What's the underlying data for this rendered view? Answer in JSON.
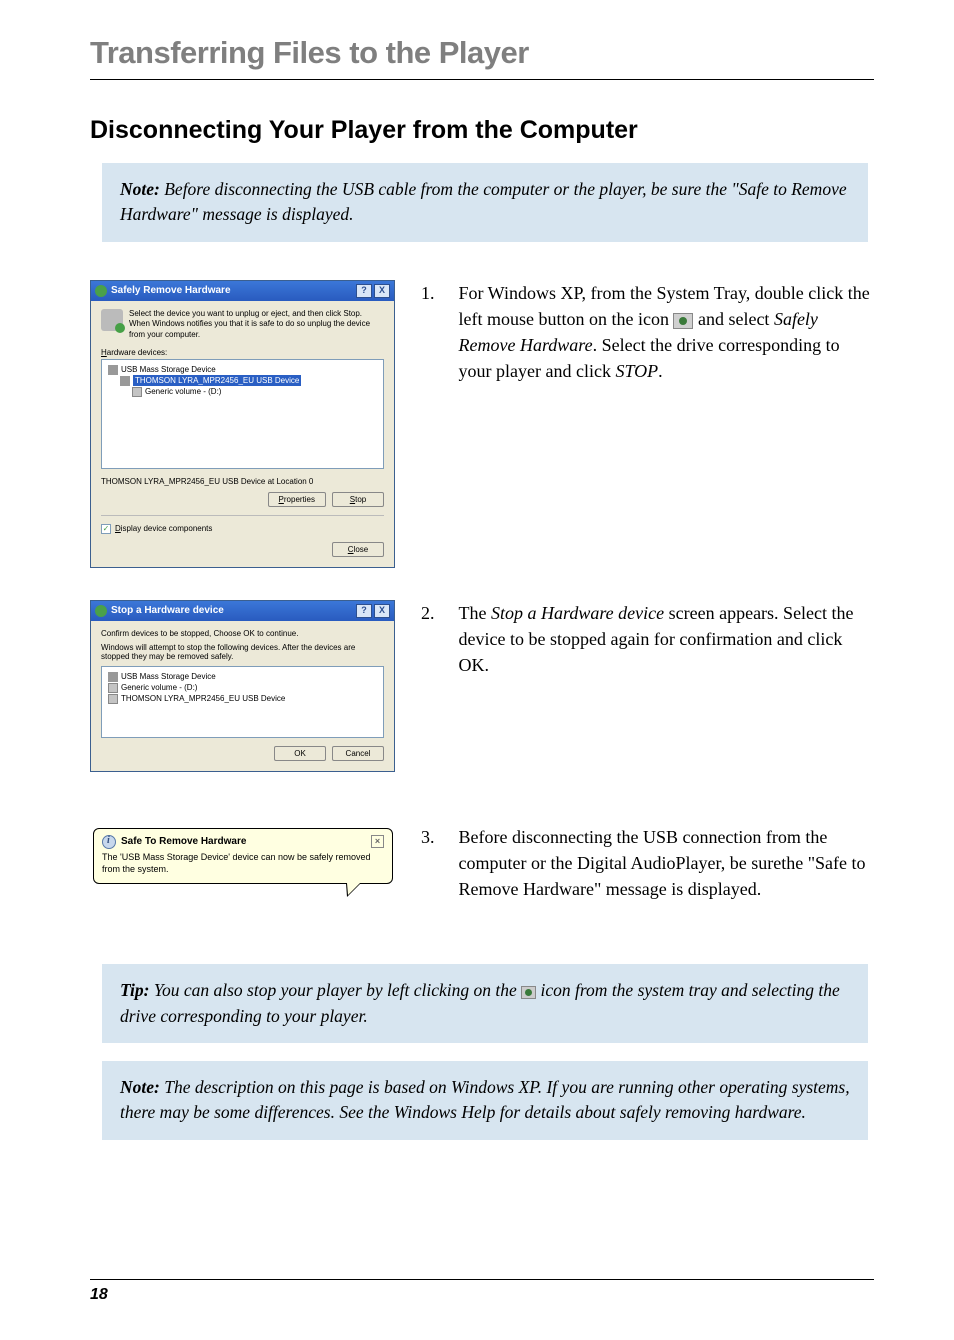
{
  "chapter_title": "Transferring Files to the Player",
  "section_title": "Disconnecting Your Player from the Computer",
  "top_note": {
    "lead": "Note:",
    "body": " Before disconnecting the USB cable from the computer or the player, be sure the \"Safe to Remove Hardware\" message is displayed."
  },
  "steps": {
    "s1": {
      "num": "1.",
      "text_a": "For Windows XP, from the System Tray, double click the left mouse button on the icon ",
      "text_b": " and select ",
      "italic1": "Safely Remove Hardware",
      "text_c": ". Select the drive corresponding to your player and click ",
      "italic2": "STOP",
      "text_d": "."
    },
    "s2": {
      "num": "2.",
      "text_a": "The ",
      "italic1": "Stop a Hardware device",
      "text_b": " screen appears. Select the device to be stopped again for confirmation and click OK."
    },
    "s3": {
      "num": "3.",
      "text": "Before disconnecting the USB connection from the computer or the Digital AudioPlayer, be surethe \"Safe to Remove Hardware\" message is displayed."
    }
  },
  "dialog1": {
    "title": "Safely Remove Hardware",
    "help_btn": "?",
    "close_btn": "X",
    "desc": "Select the device you want to unplug or eject, and then click Stop. When Windows notifies you that it is safe to do so unplug the device from your computer.",
    "hw_label": "Hardware devices:",
    "tree_root": "USB Mass Storage Device",
    "tree_sel": "THOMSON LYRA_MPR2456_EU USB Device",
    "tree_vol": "Generic volume - (D:)",
    "status": "THOMSON LYRA_MPR2456_EU USB Device at Location 0",
    "btn_properties": "Properties",
    "btn_stop": "Stop",
    "chk_label": "Display device components",
    "btn_close": "Close"
  },
  "dialog2": {
    "title": "Stop a Hardware device",
    "help_btn": "?",
    "close_btn": "X",
    "line1": "Confirm devices to be stopped, Choose OK to continue.",
    "line2": "Windows will attempt to stop the following devices. After the devices are stopped they may be removed safely.",
    "item1": "USB Mass Storage Device",
    "item2": "Generic volume - (D:)",
    "item3": "THOMSON LYRA_MPR2456_EU USB Device",
    "btn_ok": "OK",
    "btn_cancel": "Cancel"
  },
  "balloon": {
    "title": "Safe To Remove Hardware",
    "close": "×",
    "body": "The 'USB Mass Storage Device' device can now be safely removed from the system."
  },
  "tip": {
    "lead": "Tip:",
    "a": " You can also stop your player by left clicking on the ",
    "b": " icon from the system tray and selecting the drive corresponding to your player."
  },
  "bottom_note": {
    "lead": "Note:",
    "body": " The description on this page is based on Windows XP. If you are running other operating systems, there may be some differences. See the Windows Help for details about safely removing hardware."
  },
  "page_number": "18"
}
